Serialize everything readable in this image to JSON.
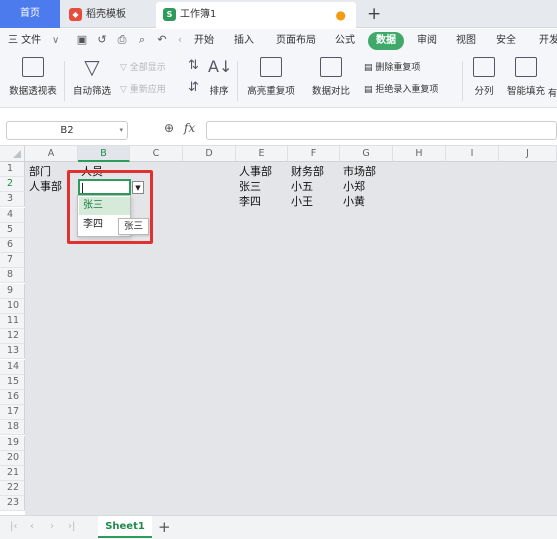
{
  "tabs": {
    "home": "首页",
    "docer": "稻壳模板",
    "workbook": "工作簿1",
    "new_tab": "+"
  },
  "menu": {
    "file": "三 文件",
    "items": [
      "开始",
      "插入",
      "页面布局",
      "公式",
      "数据",
      "审阅",
      "视图",
      "安全",
      "开发"
    ],
    "active": "数据"
  },
  "ribbon": {
    "pivot": "数据透视表",
    "autofilter": "自动筛选",
    "show_all": "全部显示",
    "reapply": "重新应用",
    "sort": "排序",
    "highlight_dup": "高亮重复项",
    "compare": "数据对比",
    "remove_dup": "删除重复项",
    "reject_dup": "拒绝录入重复项",
    "split": "分列",
    "flash_fill": "智能填充",
    "more": "有"
  },
  "formula_bar": {
    "name_box": "B2",
    "fx": "fx",
    "value": ""
  },
  "columns": [
    "A",
    "B",
    "C",
    "D",
    "E",
    "F",
    "G",
    "H",
    "I",
    "J"
  ],
  "selected_column": "B",
  "rows": [
    "1",
    "2",
    "3",
    "4",
    "5",
    "6",
    "7",
    "8",
    "9",
    "10",
    "11",
    "12",
    "13",
    "14",
    "15",
    "16",
    "17",
    "18",
    "19",
    "20",
    "21",
    "22",
    "23"
  ],
  "selected_row": "2",
  "cells": {
    "A1": "部门",
    "B1": "人员",
    "A2": "人事部",
    "E1": "人事部",
    "F1": "财务部",
    "G1": "市场部",
    "E2": "张三",
    "F2": "小五",
    "G2": "小郑",
    "E3": "李四",
    "F3": "小王",
    "G3": "小黄"
  },
  "dropdown": {
    "options": [
      "张三",
      "李四"
    ],
    "highlighted": "张三",
    "tooltip": "张三"
  },
  "sheets": {
    "active": "Sheet1",
    "add": "+"
  },
  "colors": {
    "accent": "#2e9a5b",
    "highlight_box": "#e0302f",
    "tab_home": "#4b7bec"
  }
}
